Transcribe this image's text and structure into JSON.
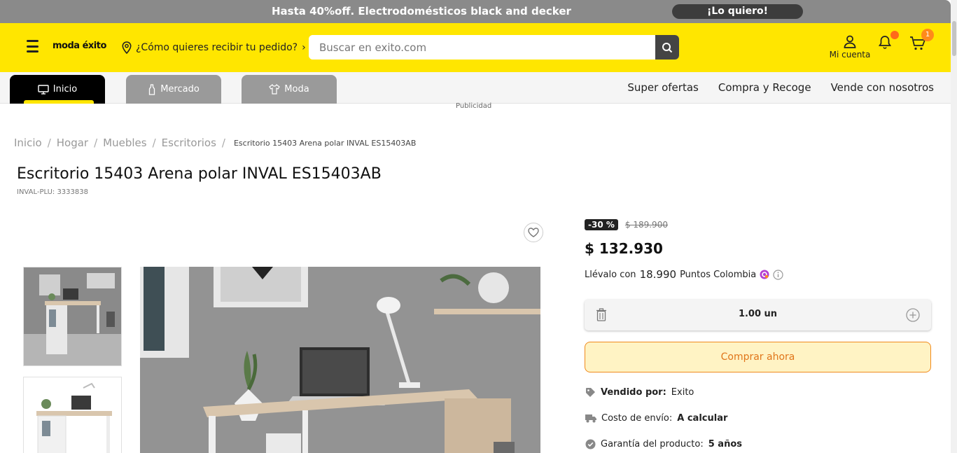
{
  "promo": {
    "text": "Hasta 40%off. Electrodomésticos black and decker",
    "cta": "¡Lo quiero!"
  },
  "header": {
    "logo": "moda éxito",
    "delivery": "¿Cómo quieres recibir tu pedido?",
    "search_placeholder": "Buscar en exito.com",
    "account_label": "Mi cuenta",
    "cart_count": "1",
    "brand_color": "#ffe600"
  },
  "nav": {
    "tabs": [
      {
        "label": "Inicio",
        "icon": "monitor-icon"
      },
      {
        "label": "Mercado",
        "icon": "bottle-icon"
      },
      {
        "label": "Moda",
        "icon": "shirt-icon"
      }
    ],
    "links": [
      "Super ofertas",
      "Compra y Recoge",
      "Vende con nosotros"
    ]
  },
  "ad_label": "Publicidad",
  "breadcrumb": {
    "items": [
      "Inicio",
      "Hogar",
      "Muebles",
      "Escritorios"
    ],
    "current": "Escritorio 15403 Arena polar INVAL ES15403AB"
  },
  "product": {
    "title": "Escritorio 15403 Arena polar INVAL ES15403AB",
    "plu": "INVAL-PLU: 3333838",
    "discount": "-30 %",
    "old_price": "$ 189.900",
    "price": "$ 132.930",
    "points_prefix": "Llévalo con",
    "points_value": "18.990",
    "points_suffix": "Puntos Colombia",
    "quantity": "1.00 un",
    "buy_label": "Comprar ahora",
    "seller_label": "Vendido por:",
    "seller_value": "Exito",
    "shipping_label": "Costo de envío:",
    "shipping_value": "A calcular",
    "warranty_label": "Garantía del producto:",
    "warranty_value": "5 años"
  }
}
